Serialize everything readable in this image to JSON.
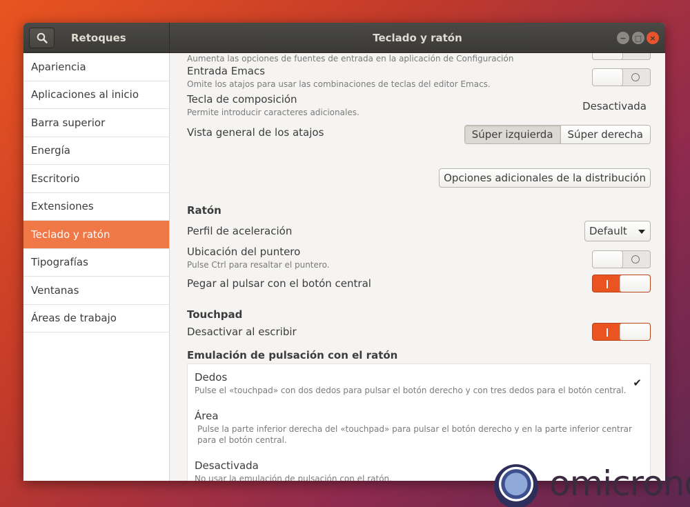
{
  "window": {
    "app_title": "Retoques",
    "title": "Teclado y ratón",
    "controls": {
      "minimize": "−",
      "maximize": "□",
      "close": "×"
    }
  },
  "sidebar": {
    "items": [
      {
        "label": "Apariencia"
      },
      {
        "label": "Aplicaciones al inicio"
      },
      {
        "label": "Barra superior"
      },
      {
        "label": "Energía"
      },
      {
        "label": "Escritorio"
      },
      {
        "label": "Extensiones"
      },
      {
        "label": "Teclado y ratón",
        "active": true
      },
      {
        "label": "Tipografías"
      },
      {
        "label": "Ventanas"
      },
      {
        "label": "Áreas de trabajo"
      }
    ]
  },
  "keyboard": {
    "partial_row_sub": "Aumenta las opciones de fuentes de entrada en la aplicación de Configuración",
    "emacs": {
      "title": "Entrada Emacs",
      "sub": "Omite los atajos para usar las combinaciones de teclas del editor Emacs.",
      "state": "off"
    },
    "compose": {
      "title": "Tecla de composición",
      "sub": "Permite introducir caracteres adicionales.",
      "value": "Desactivada"
    },
    "overview": {
      "title": "Vista general de los atajos",
      "options": [
        "Súper izquierda",
        "Súper derecha"
      ],
      "selected": "Súper izquierda"
    },
    "layout_button": "Opciones adicionales de la distribución"
  },
  "mouse": {
    "section": "Ratón",
    "accel": {
      "title": "Perfil de aceleración",
      "value": "Default"
    },
    "pointer": {
      "title": "Ubicación del puntero",
      "sub": "Pulse Ctrl para resaltar el puntero.",
      "state": "off"
    },
    "middle": {
      "title": "Pegar al pulsar con el botón central",
      "state": "on"
    }
  },
  "touchpad": {
    "section": "Touchpad",
    "disable": {
      "title": "Desactivar al escribir",
      "state": "on"
    },
    "emulation_title": "Emulación de pulsación con el ratón",
    "options": [
      {
        "title": "Dedos",
        "sub": "Pulse el «touchpad» con dos dedos para pulsar el botón derecho y con tres dedos para el botón central.",
        "checked": true
      },
      {
        "title": "Área",
        "sub": "Pulse la parte inferior derecha del «touchpad» para pulsar el botón derecho y en la parte inferior centrar para el botón central.",
        "checked": false
      },
      {
        "title": "Desactivada",
        "sub": "No usar la emulación de pulsación con el ratón.",
        "checked": false
      }
    ],
    "check_glyph": "✔"
  },
  "watermark": {
    "text": "omicrono"
  },
  "colors": {
    "accent": "#e95420",
    "selection": "#f07746",
    "titlebar": "#3b3a36"
  }
}
